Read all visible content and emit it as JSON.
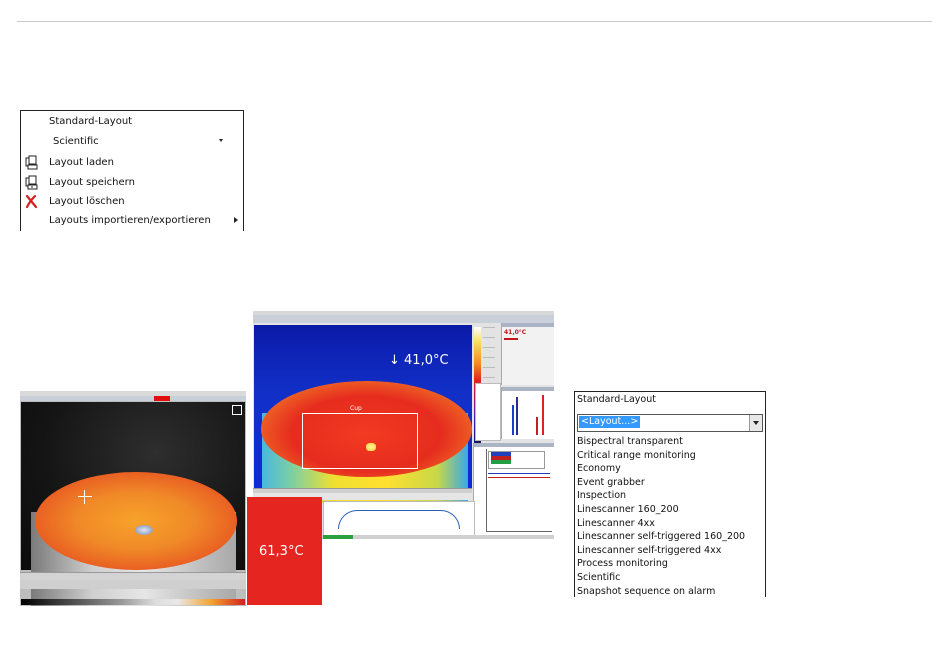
{
  "menu": {
    "items": [
      {
        "label": "Standard-Layout",
        "icon": ""
      },
      {
        "label": "Scientific",
        "icon": "",
        "submenu_caret": true
      },
      {
        "label": "Layout laden",
        "icon": "load-layout-icon"
      },
      {
        "label": "Layout speichern",
        "icon": "save-layout-icon"
      },
      {
        "label": "Layout löschen",
        "icon": "delete-icon"
      },
      {
        "label": "Layouts importieren/exportieren",
        "icon": "",
        "submenu_arrow": true
      }
    ]
  },
  "screenshot_right": {
    "temperature": "↓  41,0°C",
    "roi_label": "Cup",
    "panel_value": "41,0°C"
  },
  "red_panel": {
    "temperature": "61,3°C"
  },
  "layout_dropdown": {
    "title": "Standard-Layout",
    "selected": "<Layout...>",
    "options": [
      "Bispectral transparent",
      "Critical range monitoring",
      "Economy",
      "Event grabber",
      "Inspection",
      "Linescanner 160_200",
      "Linescanner 4xx",
      "Linescanner self-triggered 160_200",
      "Linescanner self-triggered 4xx",
      "Process monitoring",
      "Scientific",
      "Snapshot sequence on alarm"
    ]
  },
  "colors": {
    "selection_blue": "#3399ff",
    "alarm_red": "#e5251f",
    "delete_red": "#d42020"
  }
}
